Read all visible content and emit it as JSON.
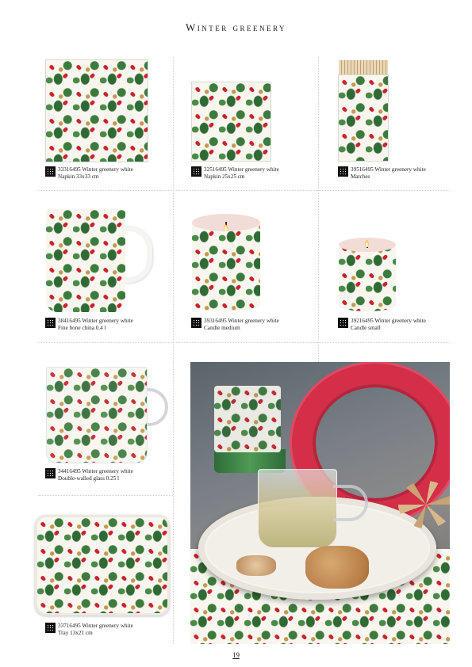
{
  "page": {
    "title": "Winter greenery",
    "page_number": "19"
  },
  "products": [
    {
      "code": "33316495",
      "name": "Winter greenery white",
      "desc": "Napkin 33x33 cm"
    },
    {
      "code": "32516495",
      "name": "Winter greenery white",
      "desc": "Napkin 25x25 cm"
    },
    {
      "code": "39516495",
      "name": "Winter greenery white",
      "desc": "Matches"
    },
    {
      "code": "38416495",
      "name": "Winter greenery white",
      "desc": "Fine bone china 0.4 l"
    },
    {
      "code": "39316495",
      "name": "Winter greenery white",
      "desc": "Candle medium"
    },
    {
      "code": "39216495",
      "name": "Winter greenery white",
      "desc": "Candle small"
    },
    {
      "code": "34416495",
      "name": "Winter greenery white",
      "desc": "Double-walled glass 0.25 l"
    },
    {
      "code": "33716495",
      "name": "Winter greenery white",
      "desc": "Tray 13x21 cm"
    }
  ],
  "colors": {
    "holly_red": "#c8242d",
    "holly_green": "#2f6a34",
    "background_cream": "#f8f6ee"
  }
}
